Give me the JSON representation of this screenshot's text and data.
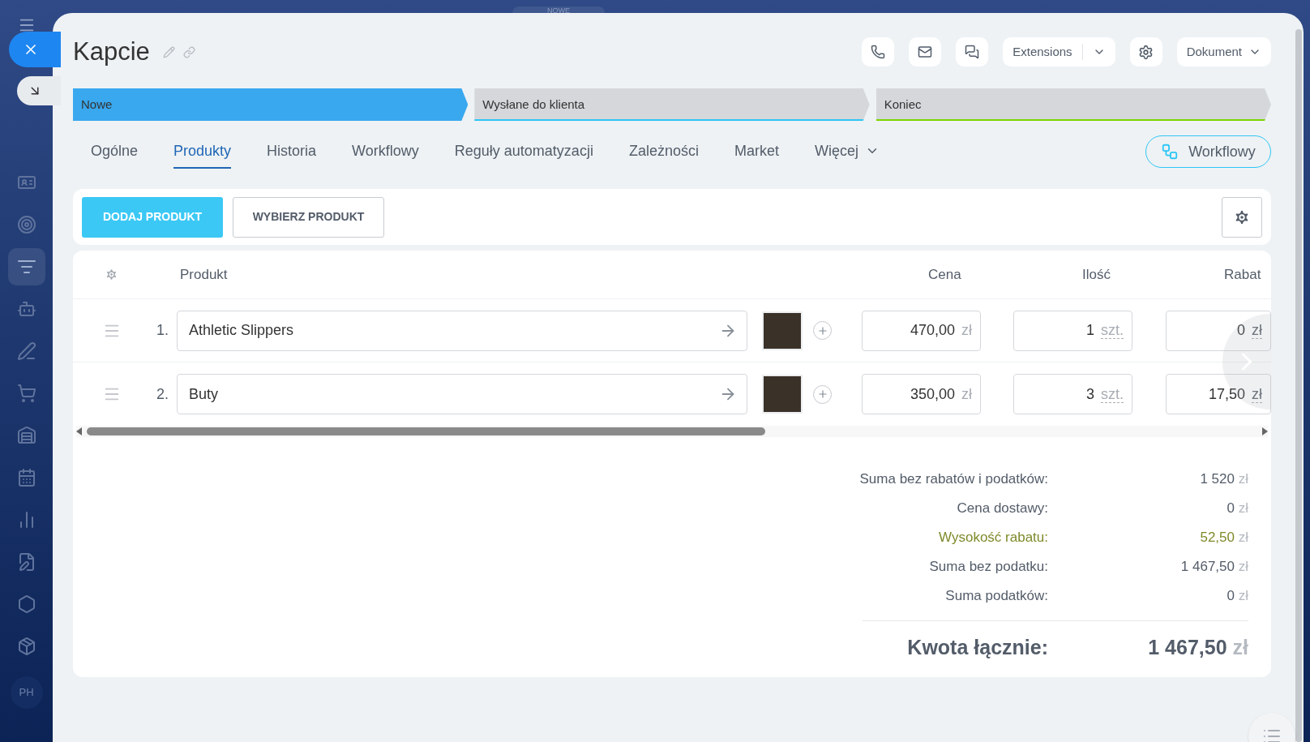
{
  "top_strip": {
    "tab": "NOWE"
  },
  "sidebar": {
    "items": [
      {
        "selected": false
      },
      {
        "selected": false
      },
      {
        "selected": true
      },
      {
        "selected": false
      },
      {
        "selected": false
      },
      {
        "selected": false
      },
      {
        "selected": false
      },
      {
        "selected": false
      },
      {
        "selected": false
      },
      {
        "selected": false
      },
      {
        "selected": false
      },
      {
        "selected": false
      }
    ],
    "avatar": "PH"
  },
  "header": {
    "title": "Kapcie",
    "actions": [
      {
        "kind": "phone"
      },
      {
        "kind": "mail"
      },
      {
        "kind": "chat"
      },
      {
        "kind": "split",
        "label": "Extensions"
      },
      {
        "kind": "settings"
      },
      {
        "kind": "dropdown",
        "label": "Dokument"
      }
    ]
  },
  "stages": [
    {
      "name": "Nowe",
      "color": "#39a8ef",
      "selected": true
    },
    {
      "name": "Wysłane do klienta",
      "color": "#2fc6f6",
      "selected": false
    },
    {
      "name": "Koniec",
      "color": "#7bd500",
      "selected": false
    }
  ],
  "tabs": [
    {
      "label": "Ogólne",
      "selected": false,
      "dropdown": false
    },
    {
      "label": "Produkty",
      "selected": true,
      "dropdown": false
    },
    {
      "label": "Historia",
      "selected": false,
      "dropdown": false
    },
    {
      "label": "Workflowy",
      "selected": false,
      "dropdown": false
    },
    {
      "label": "Reguły automatyzacji",
      "selected": false,
      "dropdown": false
    },
    {
      "label": "Zależności",
      "selected": false,
      "dropdown": false
    },
    {
      "label": "Market",
      "selected": false,
      "dropdown": false
    },
    {
      "label": "Więcej",
      "selected": false,
      "dropdown": true
    }
  ],
  "workflow_button": "Workflowy",
  "toolbar": {
    "primary": "DODAJ PRODUKT",
    "secondary": "WYBIERZ PRODUKT"
  },
  "table": {
    "columns": [
      "Produkt",
      "Cena",
      "Ilość",
      "Rabat"
    ],
    "rows": [
      {
        "number": "1.",
        "name": "Athletic Slippers",
        "price": "470,00",
        "price_currency": "zł",
        "quantity": "1",
        "unit": "szt.",
        "discount": "0",
        "discount_currency": "zł"
      },
      {
        "number": "2.",
        "name": "Buty",
        "price": "350,00",
        "price_currency": "zł",
        "quantity": "3",
        "unit": "szt.",
        "discount": "17,50",
        "discount_currency": "zł"
      }
    ]
  },
  "totals": [
    {
      "kind": "normal",
      "label": "Suma bez rabatów i podatków:",
      "value": "1 520",
      "currency": "zł"
    },
    {
      "kind": "normal",
      "label": "Cena dostawy:",
      "value": "0",
      "currency": "zł"
    },
    {
      "kind": "discount",
      "label": "Wysokość rabatu:",
      "value": "52,50",
      "currency": "zł"
    },
    {
      "kind": "normal",
      "label": "Suma bez podatku:",
      "value": "1 467,50",
      "currency": "zł"
    },
    {
      "kind": "normal",
      "label": "Suma podatków:",
      "value": "0",
      "currency": "zł"
    }
  ],
  "grand_total": {
    "label": "Kwota łącznie:",
    "value": "1 467,50",
    "currency": "zł"
  }
}
